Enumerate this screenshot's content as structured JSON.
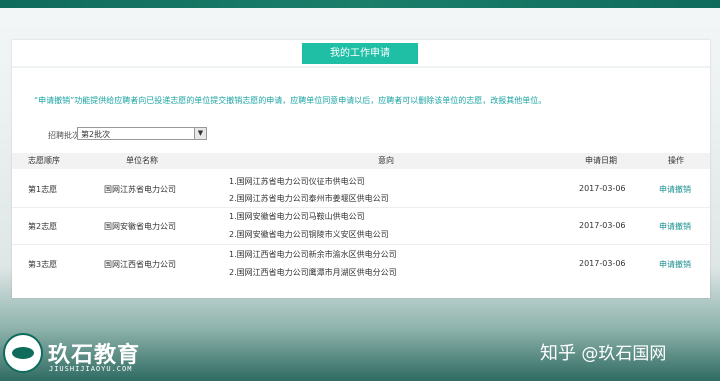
{
  "panel": {
    "title": "我的工作申请",
    "notice": "“申请撤销”功能提供给应聘者向已投递志愿的单位提交撤销志愿的申请，应聘单位同意申请以后，应聘者可以删除该单位的志愿，改报其他单位。",
    "batch_label": "招聘批次:",
    "batch_value": "第2批次"
  },
  "table": {
    "headers": [
      "志愿顺序",
      "单位名称",
      "意向",
      "申请日期",
      "操作"
    ],
    "rows": [
      {
        "seq": "第1志愿",
        "unit": "国网江苏省电力公司",
        "will1": "1.国网江苏省电力公司仪征市供电公司",
        "will2": "2.国网江苏省电力公司泰州市姜堰区供电公司",
        "date": "2017-03-06",
        "action": "申请撤销"
      },
      {
        "seq": "第2志愿",
        "unit": "国网安徽省电力公司",
        "will1": "1.国网安徽省电力公司马鞍山供电公司",
        "will2": "2.国网安徽省电力公司铜陵市义安区供电公司",
        "date": "2017-03-06",
        "action": "申请撤销"
      },
      {
        "seq": "第3志愿",
        "unit": "国网江西省电力公司",
        "will1": "1.国网江西省电力公司新余市渝水区供电分公司",
        "will2": "2.国网江西省电力公司鹰潭市月湖区供电分公司",
        "date": "2017-03-06",
        "action": "申请撤销"
      }
    ]
  },
  "branding": {
    "logo_text": "玖石教育",
    "logo_sub": "JIUSHIJIAOYU.COM",
    "watermark_site": "知乎",
    "watermark_handle": "@玖石国网"
  },
  "colors": {
    "accent": "#1fbfa6",
    "link": "#1a8f8f",
    "brand": "#0f6b5c"
  }
}
